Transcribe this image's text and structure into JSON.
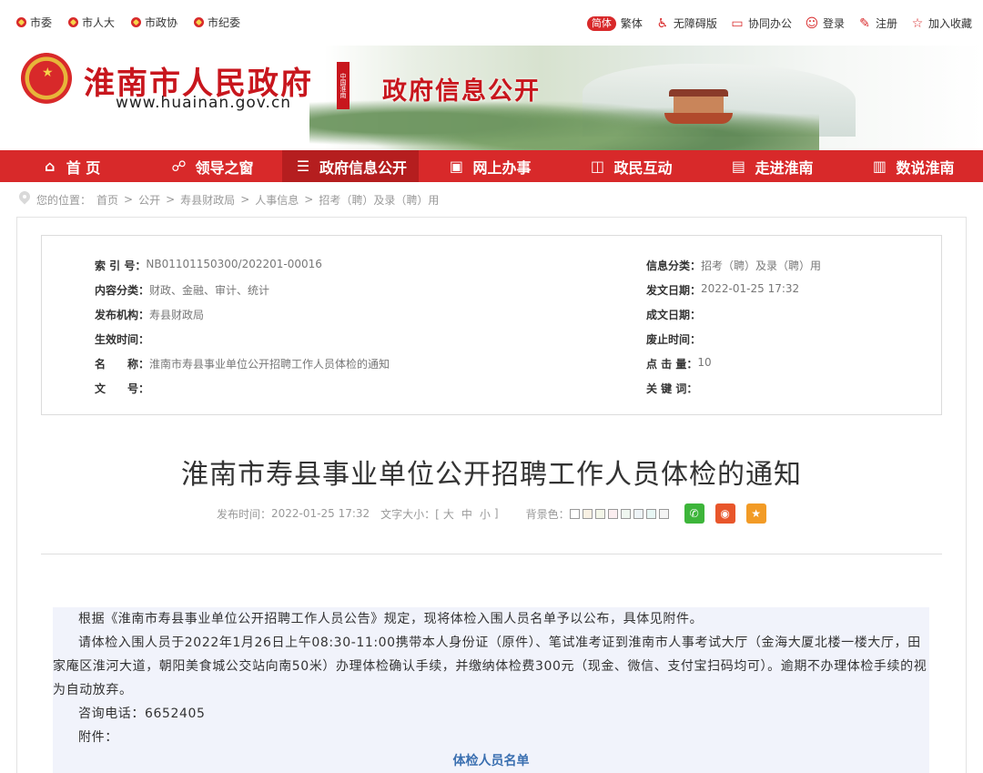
{
  "top_links": [
    {
      "label": "市委",
      "icon": "party-emblem-icon"
    },
    {
      "label": "市人大",
      "icon": "party-emblem-icon"
    },
    {
      "label": "市政协",
      "icon": "party-emblem-icon"
    },
    {
      "label": "市纪委",
      "icon": "party-emblem-icon"
    }
  ],
  "toolbar": {
    "lang_simplified": "简体",
    "lang_traditional": "繁体",
    "accessibility": "无障碍版",
    "office": "协同办公",
    "login": "登录",
    "register": "注册",
    "favorite": "加入收藏"
  },
  "header": {
    "site_name": "淮南市人民政府",
    "site_domain": "www.huainan.gov.cn",
    "seal_text": "中国淮南",
    "section_name": "政府信息公开"
  },
  "nav": [
    {
      "label": "首 页",
      "icon": "home-icon"
    },
    {
      "label": "领导之窗",
      "icon": "people-icon"
    },
    {
      "label": "政府信息公开",
      "icon": "document-icon"
    },
    {
      "label": "网上办事",
      "icon": "monitor-icon"
    },
    {
      "label": "政民互动",
      "icon": "chat-icon"
    },
    {
      "label": "走进淮南",
      "icon": "building-icon"
    },
    {
      "label": "数说淮南",
      "icon": "bar-chart-icon"
    }
  ],
  "nav_active_index": 2,
  "breadcrumb": {
    "prefix": "您的位置：",
    "items": [
      "首页",
      "公开",
      "寿县财政局",
      "人事信息",
      "招考（聘）及录（聘）用"
    ]
  },
  "meta": {
    "index_label": "索 引 号：",
    "index_value": "NB01101150300/202201-00016",
    "category_label": "信息分类：",
    "category_value": "招考（聘）及录（聘）用",
    "content_label": "内容分类：",
    "content_value": "财政、金融、审计、统计",
    "pubdate_label": "发文日期：",
    "pubdate_value": "2022-01-25 17:32",
    "org_label": "发布机构：",
    "org_value": "寿县财政局",
    "formdate_label": "成文日期：",
    "formdate_value": "",
    "effective_label": "生效时间：",
    "effective_value": "",
    "expire_label": "废止时间：",
    "expire_value": "",
    "name_label": "名　　称：",
    "name_value": "淮南市寿县事业单位公开招聘工作人员体检的通知",
    "clicks_label": "点 击 量：",
    "clicks_value": "10",
    "docno_label": "文　　号：",
    "docno_value": "",
    "keywords_label": "关 键 词：",
    "keywords_value": ""
  },
  "article": {
    "title": "淮南市寿县事业单位公开招聘工作人员体检的通知",
    "publish_label": "发布时间：",
    "publish_time": "2022-01-25 17:32",
    "font_size_label": "文字大小：[",
    "font_big": "大",
    "font_mid": "中",
    "font_small": "小",
    "font_close": "]",
    "bg_label": "背景色：",
    "bg_colors": [
      "#ffffff",
      "#f9f1e3",
      "#f3f6e8",
      "#fbeef0",
      "#eff7f0",
      "#eef4f8",
      "#e7f6f4",
      "#f5f5f5"
    ],
    "share_icons": [
      {
        "name": "wechat-icon",
        "color": "#3db53a"
      },
      {
        "name": "weibo-icon",
        "color": "#e8562b"
      },
      {
        "name": "favorite-star-icon",
        "color": "#f29b26"
      }
    ],
    "paragraphs": [
      "根据《淮南市寿县事业单位公开招聘工作人员公告》规定，现将体检入围人员名单予以公布，具体见附件。",
      "请体检入围人员于2022年1月26日上午08:30-11:00携带本人身份证（原件）、笔试准考证到淮南市人事考试大厅（金海大厦北楼一楼大厅，田家庵区淮河大道，朝阳美食城公交站向南50米）办理体检确认手续，并缴纳体检费300元（现金、微信、支付宝扫码均可）。逾期不办理体检手续的视为自动放弃。",
      "咨询电话：6652405",
      "附件："
    ],
    "annex_title": "体检人员名单"
  }
}
